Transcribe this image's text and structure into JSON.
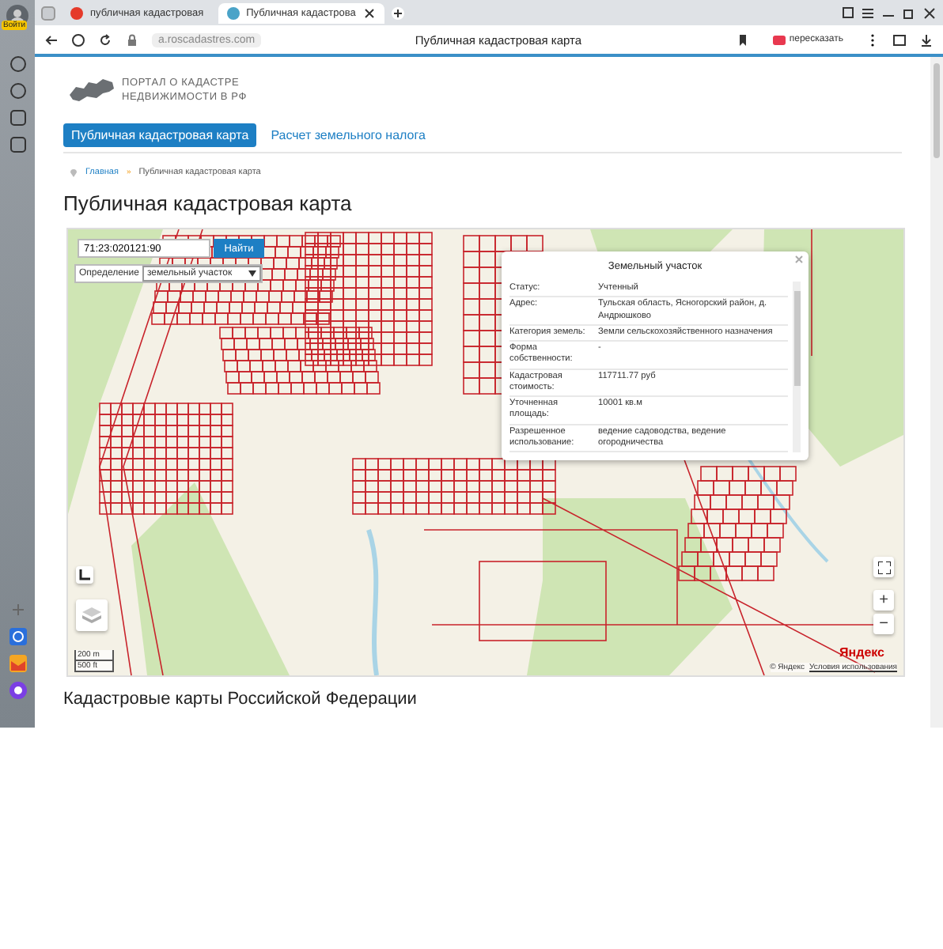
{
  "browser": {
    "profile_badge": "Войти",
    "tabs": [
      {
        "title": "публичная кадастровая",
        "selected": false
      },
      {
        "title": "Публичная кадастрова",
        "selected": true
      }
    ],
    "address": "a.roscadastres.com",
    "page_title": "Публичная кадастровая карта",
    "summarize_button": "пересказать"
  },
  "site": {
    "logo_lines": [
      "ПОРТАЛ О КАДАСТРЕ",
      "НЕДВИЖИМОСТИ В РФ"
    ],
    "nav": [
      {
        "label": "Публичная кадастровая карта",
        "selected": true
      },
      {
        "label": "Расчет земельного налога",
        "selected": false
      }
    ],
    "breadcrumbs": [
      "Главная",
      "Публичная кадастровая карта"
    ],
    "breadcrumb_separator": "»",
    "heading": "Публичная кадастровая карта"
  },
  "map": {
    "search": {
      "value": "71:23:020121:90",
      "button": "Найти"
    },
    "mode": {
      "label": "Определение",
      "value": "земельный участок"
    },
    "popup": {
      "title": "Земельный участок",
      "rows": [
        {
          "label": "Статус:",
          "value": "Учтенный"
        },
        {
          "label": "Адрес:",
          "value": "Тульская область, Ясногорский район, д. Андрюшково"
        },
        {
          "label": "Категория земель:",
          "value": "Земли сельскохозяйственного назначения"
        },
        {
          "label": "Форма собственности:",
          "value": "-"
        },
        {
          "label": "Кадастровая стоимость:",
          "value": "117711.77 руб"
        },
        {
          "label": "Уточненная площадь:",
          "value": "10001 кв.м"
        },
        {
          "label": "Разрешенное использование:",
          "value": "ведение садоводства, ведение огородничества"
        }
      ]
    },
    "zoom": [
      "+",
      "−"
    ],
    "scale": [
      "200 m",
      "500 ft"
    ],
    "provider_logo": "Яндекс",
    "attribution": "© Яндекс",
    "terms_link": "Условия использования"
  },
  "section_heading": "Кадастровые карты Российской Федерации"
}
